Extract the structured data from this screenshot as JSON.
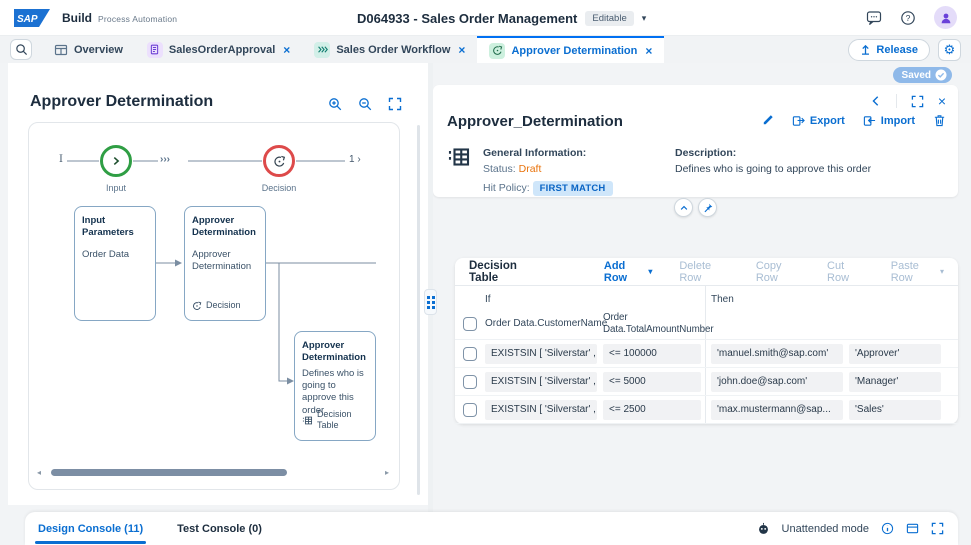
{
  "header": {
    "logo": "SAP",
    "product": "Build",
    "product_suffix": "Process Automation",
    "title": "D064933 - Sales Order Management",
    "editable_badge": "Editable"
  },
  "tabbar": {
    "tabs": [
      {
        "label": "Overview"
      },
      {
        "label": "SalesOrderApproval"
      },
      {
        "label": "Sales Order Workflow"
      },
      {
        "label": "Approver Determination"
      }
    ],
    "release_label": "Release"
  },
  "canvas_panel": {
    "title": "Approver Determination",
    "flow": {
      "start_marker": "I",
      "skip_marker": "›››",
      "end_marker": "1 ›",
      "input_label": "Input",
      "decision_label": "Decision",
      "input_box": {
        "title": "Input Parameters",
        "body": "Order Data"
      },
      "decision_box": {
        "title": "Approver Determination",
        "body": "Approver Determination",
        "footer": "Decision"
      },
      "info_box": {
        "title": "Approver Determination",
        "body": "Defines who is going to approve this order",
        "footer": "Decision Table"
      }
    }
  },
  "detail_panel": {
    "saved_badge": "Saved",
    "title": "Approver_Determination",
    "export_label": "Export",
    "import_label": "Import",
    "general_info_label": "General Information:",
    "status_label": "Status:",
    "status_value": "Draft",
    "hit_policy_label": "Hit Policy:",
    "hit_policy_value": "FIRST MATCH",
    "description_label": "Description:",
    "description_value": "Defines who is going to approve this order"
  },
  "decision_table": {
    "title": "Decision Table",
    "actions": {
      "add": "Add Row",
      "delete": "Delete Row",
      "copy": "Copy Row",
      "cut": "Cut Row",
      "paste": "Paste Row"
    },
    "if_label": "If",
    "then_label": "Then",
    "columns": [
      "Order Data.CustomerName",
      "Order Data.TotalAmountNumber"
    ],
    "rows": [
      {
        "condition_customer": "EXISTSIN [ 'Silverstar' , '...",
        "condition_amount": "<= 100000",
        "result_email": "'manuel.smith@sap.com'",
        "result_role": "'Approver'"
      },
      {
        "condition_customer": "EXISTSIN [ 'Silverstar' , '...",
        "condition_amount": "<= 5000",
        "result_email": "'john.doe@sap.com'",
        "result_role": "'Manager'"
      },
      {
        "condition_customer": "EXISTSIN [ 'Silverstar' , '...",
        "condition_amount": "<= 2500",
        "result_email": "'max.mustermann@sap...",
        "result_role": "'Sales'"
      }
    ]
  },
  "console_bar": {
    "design_tab": "Design Console (11)",
    "test_tab": "Test Console (0)",
    "unattended_label": "Unattended mode"
  },
  "colors": {
    "accent_blue": "#0a6ed1",
    "active_tab_border": "#0070f2",
    "status_draft_orange": "#e9730c",
    "hit_policy_badge_bg": "#cfe6fa",
    "saved_pill_bg": "#8fb9e9",
    "flow_green": "#2f9e44",
    "flow_red": "#dd4a4a"
  }
}
